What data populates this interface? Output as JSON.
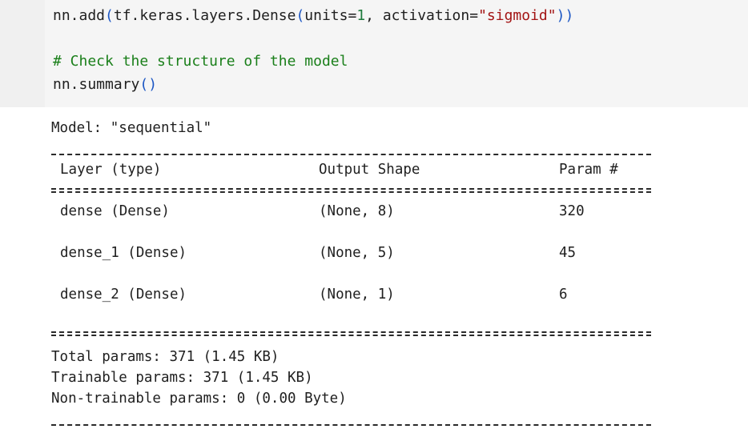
{
  "code": {
    "line1": {
      "prefix": "nn.add",
      "p1": "(",
      "mid": "tf.keras.layers.Dense",
      "p2": "(",
      "arg1": "units=",
      "num": "1",
      "arg2": ", activation=",
      "str": "\"sigmoid\"",
      "close": "))"
    },
    "comment": "# Check the structure of the model",
    "line3": {
      "prefix": "nn.summary",
      "parens": "()"
    }
  },
  "summary": {
    "model_title": "Model: \"sequential\"",
    "headers": {
      "layer": "Layer (type)",
      "output_shape": "Output Shape",
      "params": "Param #"
    },
    "rows": [
      {
        "layer": "dense (Dense)",
        "shape": "(None, 8)",
        "params": "320"
      },
      {
        "layer": "dense_1 (Dense)",
        "shape": "(None, 5)",
        "params": "45"
      },
      {
        "layer": "dense_2 (Dense)",
        "shape": "(None, 1)",
        "params": "6"
      }
    ],
    "total": "Total params: 371 (1.45 KB)",
    "trainable": "Trainable params: 371 (1.45 KB)",
    "non_trainable": "Non-trainable params: 0 (0.00 Byte)"
  }
}
